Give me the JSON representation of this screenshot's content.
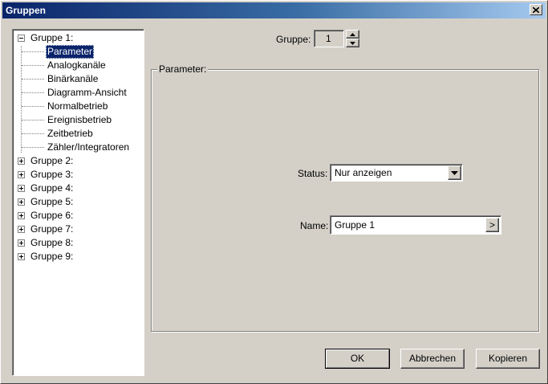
{
  "window": {
    "title": "Gruppen"
  },
  "tree": {
    "expanded_group": "Gruppe 1:",
    "children": [
      "Parameter",
      "Analogkanäle",
      "Binärkanäle",
      "Diagramm-Ansicht",
      "Normalbetrieb",
      "Ereignisbetrieb",
      "Zeitbetrieb",
      "Zähler/Integratoren"
    ],
    "selected": "Parameter",
    "collapsed_groups": [
      "Gruppe 2:",
      "Gruppe 3:",
      "Gruppe 4:",
      "Gruppe 5:",
      "Gruppe 6:",
      "Gruppe 7:",
      "Gruppe 8:",
      "Gruppe 9:"
    ]
  },
  "group_selector": {
    "label": "Gruppe:",
    "value": "1"
  },
  "parameter_box": {
    "legend": "Parameter:",
    "status_label": "Status:",
    "status_value": "Nur anzeigen",
    "name_label": "Name:",
    "name_value": "Gruppe 1",
    "name_button": ">"
  },
  "buttons": {
    "ok": "OK",
    "cancel": "Abbrechen",
    "copy": "Kopieren"
  }
}
